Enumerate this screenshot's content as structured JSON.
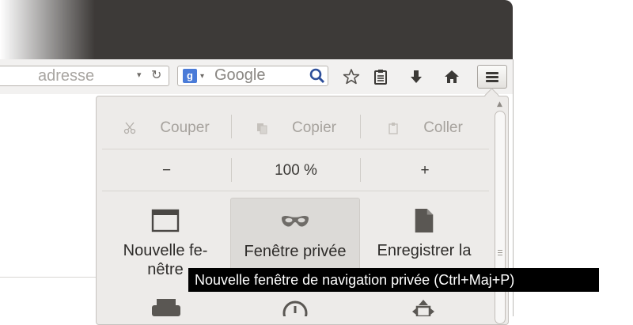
{
  "window": {
    "frame_color": "#3d3a38"
  },
  "navbar": {
    "url_placeholder": "adresse",
    "url_dropdown_glyph": "▾",
    "reload_glyph": "↻",
    "search_engine_letter": "g",
    "search_dropdown_glyph": "▾",
    "search_placeholder": "Google",
    "icons": [
      "bookmark-star-icon",
      "reading-list-icon",
      "download-icon",
      "home-icon",
      "hamburger-menu-icon"
    ]
  },
  "menu_panel": {
    "edit": {
      "cut": "Couper",
      "copy": "Copier",
      "paste": "Coller"
    },
    "zoom": {
      "reduce": "−",
      "level": "100 %",
      "enlarge": "+"
    },
    "tiles": [
      {
        "icon": "new-window-icon",
        "label_line1": "Nouvelle fe-",
        "label_line2": "nêtre"
      },
      {
        "icon": "private-mask-icon",
        "label_line1": "Fenêtre privée",
        "label_line2": ""
      },
      {
        "icon": "save-page-icon",
        "label_line1": "Enregistrer la",
        "label_line2": ""
      }
    ],
    "bottom_icons": [
      "print-icon",
      "history-icon",
      "fullscreen-icon"
    ]
  },
  "tooltip": {
    "text": "Nouvelle fenêtre de navigation privée (Ctrl+Maj+P)"
  }
}
